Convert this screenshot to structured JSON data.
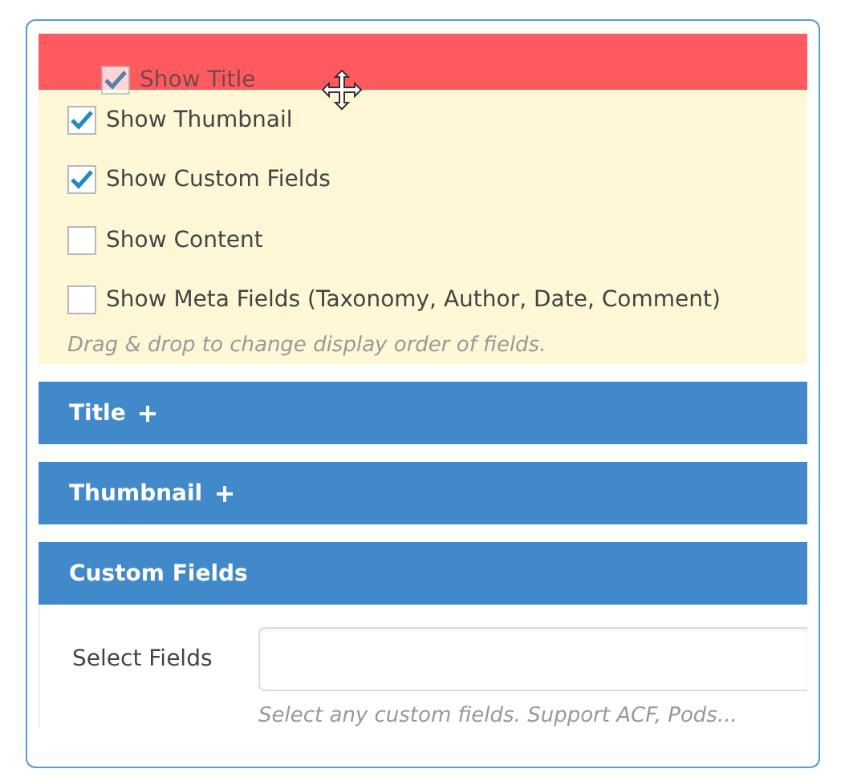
{
  "display_options": [
    {
      "label": "Show Title",
      "checked": true,
      "dragging": true
    },
    {
      "label": "Show Thumbnail",
      "checked": true,
      "dragging": false
    },
    {
      "label": "Show Custom Fields",
      "checked": true,
      "dragging": false
    },
    {
      "label": "Show Content",
      "checked": false,
      "dragging": false
    },
    {
      "label": "Show Meta Fields (Taxonomy, Author, Date, Comment)",
      "checked": false,
      "dragging": false
    }
  ],
  "display_hint": "Drag & drop to change display order of fields.",
  "sections": [
    {
      "title": "Title",
      "expanded": false
    },
    {
      "title": "Thumbnail",
      "expanded": false
    },
    {
      "title": "Custom Fields",
      "expanded": true
    }
  ],
  "custom_fields": {
    "label": "Select Fields",
    "hint": "Select any custom fields. Support ACF, Pods..."
  }
}
